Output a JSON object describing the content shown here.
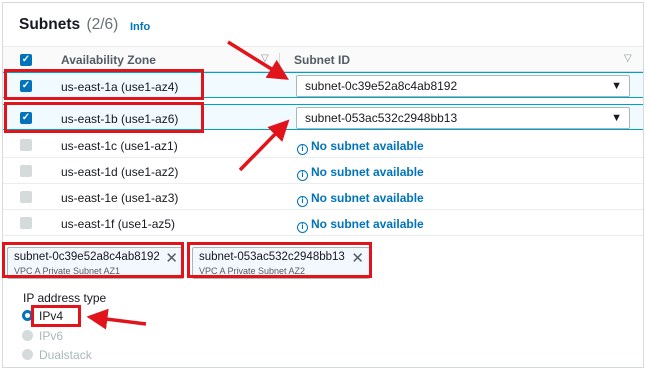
{
  "header": {
    "title": "Subnets",
    "count": "(2/6)",
    "info_link": "Info"
  },
  "table": {
    "columns": [
      "Availability Zone",
      "Subnet ID"
    ],
    "rows": [
      {
        "az": "us-east-1a (use1-az4)",
        "checked": true,
        "subnet": "subnet-0c39e52a8c4ab8192"
      },
      {
        "az": "us-east-1b (use1-az6)",
        "checked": true,
        "subnet": "subnet-053ac532c2948bb13"
      },
      {
        "az": "us-east-1c (use1-az1)",
        "checked": false,
        "subnet": "No subnet available"
      },
      {
        "az": "us-east-1d (use1-az2)",
        "checked": false,
        "subnet": "No subnet available"
      },
      {
        "az": "us-east-1e (use1-az3)",
        "checked": false,
        "subnet": "No subnet available"
      },
      {
        "az": "us-east-1f (use1-az5)",
        "checked": false,
        "subnet": "No subnet available"
      }
    ]
  },
  "tokens": [
    {
      "id": "subnet-0c39e52a8c4ab8192",
      "name": "VPC A Private Subnet AZ1"
    },
    {
      "id": "subnet-053ac532c2948bb13",
      "name": "VPC A Private Subnet AZ2"
    }
  ],
  "ip_address_type": {
    "label": "IP address type",
    "options": [
      {
        "label": "IPv4",
        "selected": true,
        "enabled": true
      },
      {
        "label": "IPv6",
        "selected": false,
        "enabled": false
      },
      {
        "label": "Dualstack",
        "selected": false,
        "enabled": false
      }
    ]
  },
  "colors": {
    "accent": "#0073bb",
    "annotation_red": "#e2141b",
    "selected_row": "#f1faff"
  }
}
